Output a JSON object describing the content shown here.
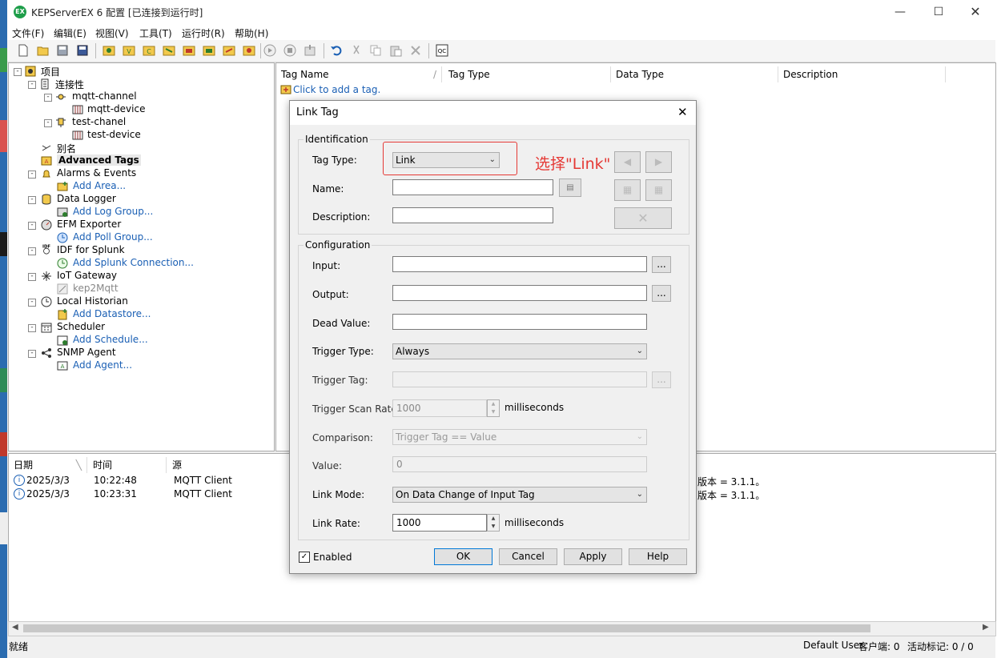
{
  "window": {
    "app_icon": "EX",
    "title": "KEPServerEX 6 配置 [已连接到运行时]"
  },
  "menu": [
    "文件(F)",
    "编辑(E)",
    "视图(V)",
    "工具(T)",
    "运行时(R)",
    "帮助(H)"
  ],
  "tree": {
    "project": "项目",
    "connectivity": "连接性",
    "mqtt_channel": "mqtt-channel",
    "mqtt_device": "mqtt-device",
    "test_channel": "test-chanel",
    "test_device": "test-device",
    "aliases": "别名",
    "advanced_tags": "Advanced Tags",
    "alarms": "Alarms & Events",
    "add_area": "Add Area...",
    "data_logger": "Data Logger",
    "add_log_group": "Add Log Group...",
    "efm": "EFM Exporter",
    "add_poll_group": "Add Poll Group...",
    "idf": "IDF for Splunk",
    "add_splunk": "Add Splunk Connection...",
    "iot": "IoT Gateway",
    "kep2mqtt": "kep2Mqtt",
    "historian": "Local Historian",
    "add_datastore": "Add Datastore...",
    "scheduler": "Scheduler",
    "add_schedule": "Add Schedule...",
    "snmp": "SNMP Agent",
    "add_agent": "Add Agent..."
  },
  "tag_table": {
    "columns": [
      "Tag Name",
      "Tag Type",
      "Data Type",
      "Description"
    ],
    "add_row": "Click to add a tag."
  },
  "log": {
    "columns": [
      "日期",
      "时间",
      "源"
    ],
    "rows": [
      {
        "date": "2025/3/3",
        "time": "10:22:48",
        "source": "MQTT Client",
        "message": "版本 = 3.1.1。"
      },
      {
        "date": "2025/3/3",
        "time": "10:23:31",
        "source": "MQTT Client",
        "message": "版本 = 3.1.1。"
      }
    ]
  },
  "status": {
    "ready": "就绪",
    "user": "Default User",
    "clients": "客户端: 0",
    "active_tags": "活动标记: 0 / 0"
  },
  "dialog": {
    "title": "Link Tag",
    "identification": "Identification",
    "tag_type_label": "Tag Type:",
    "tag_type_value": "Link",
    "annotation": "选择\"Link\"",
    "name_label": "Name:",
    "name_value": "",
    "description_label": "Description:",
    "description_value": "",
    "configuration": "Configuration",
    "input_label": "Input:",
    "output_label": "Output:",
    "dead_value_label": "Dead Value:",
    "trigger_type_label": "Trigger Type:",
    "trigger_type_value": "Always",
    "trigger_tag_label": "Trigger Tag:",
    "trigger_scan_rate_label": "Trigger Scan Rate:",
    "trigger_scan_rate_value": "1000",
    "milliseconds": "milliseconds",
    "comparison_label": "Comparison:",
    "comparison_value": "Trigger Tag == Value",
    "value_label": "Value:",
    "value_value": "0",
    "link_mode_label": "Link Mode:",
    "link_mode_value": "On Data Change of Input Tag",
    "link_rate_label": "Link Rate:",
    "link_rate_value": "1000",
    "browse": "...",
    "enabled_label": "Enabled",
    "ok": "OK",
    "cancel": "Cancel",
    "apply": "Apply",
    "help": "Help"
  },
  "colors": {
    "annotation_red": "#e53935",
    "link_blue": "#1a5fb4",
    "default_button_border": "#0078d7"
  }
}
